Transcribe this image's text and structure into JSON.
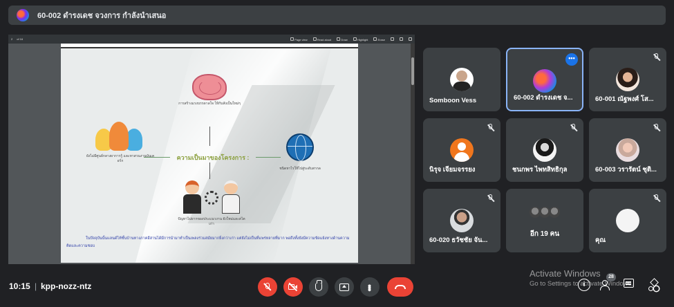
{
  "banner": {
    "title": "60-002 ดำรงเดช จวงการ กำลังนำเสนอ"
  },
  "pdf_toolbar": {
    "left": [
      "2",
      "of 16"
    ],
    "items": [
      "Page view",
      "Read aloud",
      "Draw",
      "Highlight",
      "Erase"
    ]
  },
  "slide": {
    "title": "ความเป็นมาของโครงการ :",
    "brain_caption": "การสร้างแรงบรรดาลใจ ให้กับสังเป็นใหม่ๆ",
    "people_caption": "ยังไม่มีศูนย์กลางผาการรู้ และหาสวนงานบันเคอร์ก",
    "globe_caption": "ชนิดหาไรให้ไปสู่ระดับสากล",
    "workers_caption": "ปัญหาไม่ยากของประแนวงาน ยังใหม่และสไตเก่า",
    "paragraph": "ในปัจจุบันนั้นแลนด์ไท้ชั้นบ้านทางภาคอีสานได้มีการนำมาทำเป็นเพลงร่วมสมัยมากยิ่งกว่าเก่า แต่ยังไม่เป็นที่แพร่หลายที่มาก พอถึงทั้งยังมีความขัดแย้งทางด้านความคิดและความชอบ"
  },
  "participants": [
    {
      "name": "Somboon Vess",
      "muted": false,
      "avatar": "photo-man"
    },
    {
      "name": "60-002 ดำรงเดช จ...",
      "muted": false,
      "active": true,
      "avatar": "gradient-logo"
    },
    {
      "name": "60-001 ณัฐพงศ์ โส...",
      "muted": true,
      "avatar": "photo-person"
    },
    {
      "name": "นิรุจ เจียมจรรยง",
      "muted": true,
      "avatar": "default-orange"
    },
    {
      "name": "ชนกพร ไพทสิทธิกุล",
      "muted": true,
      "avatar": "photo-bw"
    },
    {
      "name": "60-003 วรารัตน์ ชุติ...",
      "muted": true,
      "avatar": "photo-woman"
    },
    {
      "name": "60-020 ธวัชชัย จัน...",
      "muted": true,
      "avatar": "photo-man2"
    },
    {
      "name": "อีก 19 คน",
      "muted": false,
      "avatar": "group"
    },
    {
      "name": "คุณ",
      "muted": true,
      "avatar": "photo-white"
    }
  ],
  "more_button_label": "•••",
  "bottom_bar": {
    "time": "10:15",
    "separator": "|",
    "meeting_code": "kpp-nozz-ntz",
    "people_count": "28",
    "info_icon_label": "i"
  },
  "watermark": {
    "line1": "Activate Windows",
    "line2": "Go to Settings to activate Windows."
  },
  "colors": {
    "background": "#202124",
    "tile": "#3c4043",
    "accent_blue": "#8ab4f8",
    "danger_red": "#ea4335",
    "slide_title": "#8a9f3c",
    "slide_text": "#2e3ea8"
  }
}
